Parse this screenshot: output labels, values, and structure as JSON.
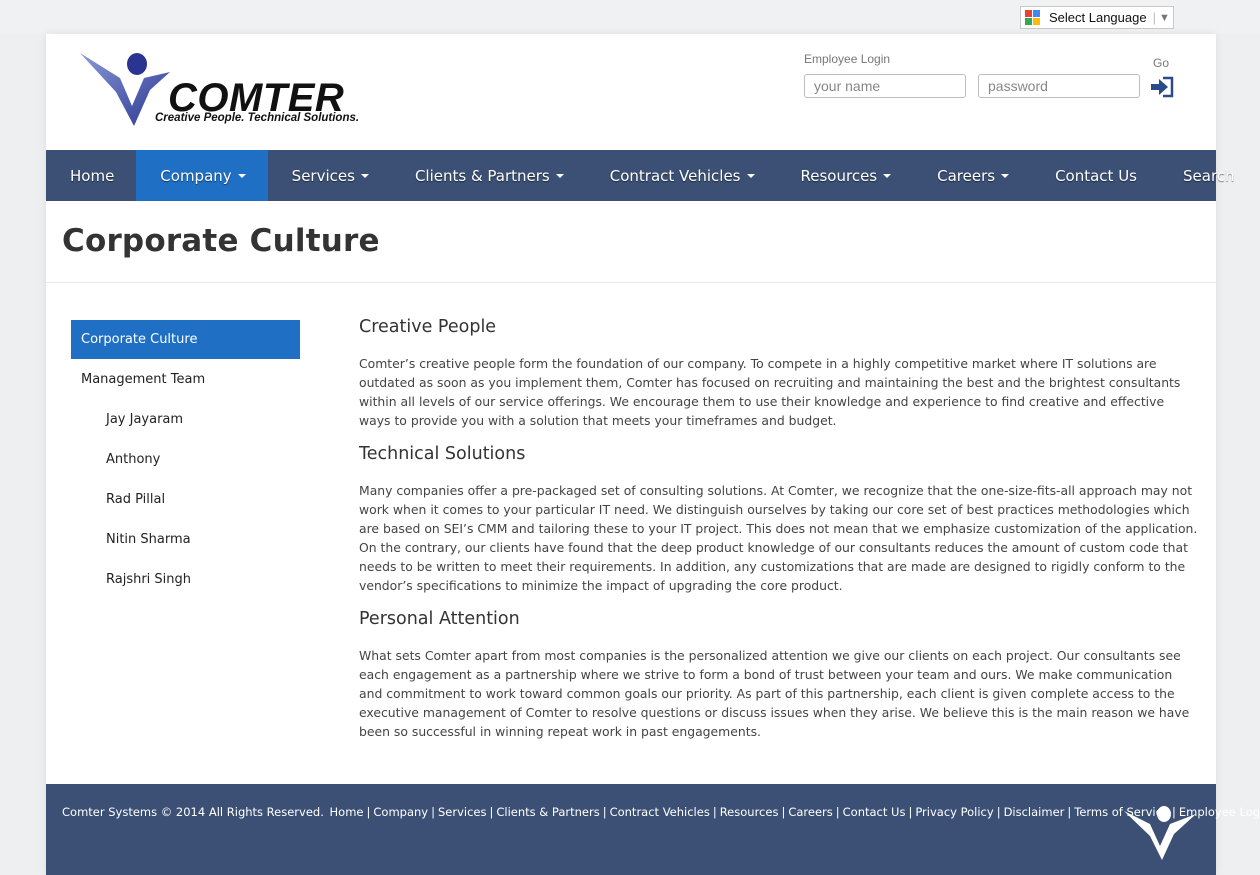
{
  "translate": {
    "label": "Select Language",
    "arrow": "▼"
  },
  "logo": {
    "name": "COMTER",
    "tagline": "Creative People. Technical Solutions."
  },
  "login": {
    "title": "Employee Login",
    "username_placeholder": "your name",
    "password_placeholder": "password",
    "go_label": "Go"
  },
  "nav": [
    {
      "label": "Home",
      "dropdown": false,
      "active": false
    },
    {
      "label": "Company",
      "dropdown": true,
      "active": true
    },
    {
      "label": "Services",
      "dropdown": true,
      "active": false
    },
    {
      "label": "Clients & Partners",
      "dropdown": true,
      "active": false
    },
    {
      "label": "Contract Vehicles",
      "dropdown": true,
      "active": false
    },
    {
      "label": "Resources",
      "dropdown": true,
      "active": false
    },
    {
      "label": "Careers",
      "dropdown": true,
      "active": false
    },
    {
      "label": "Contact Us",
      "dropdown": false,
      "active": false
    },
    {
      "label": "Search",
      "dropdown": false,
      "active": false
    }
  ],
  "page_title": "Corporate Culture",
  "sidebar": [
    {
      "label": "Corporate Culture",
      "active": true,
      "sub": false
    },
    {
      "label": "Management Team",
      "active": false,
      "sub": false
    },
    {
      "label": "Jay Jayaram",
      "active": false,
      "sub": true
    },
    {
      "label": "Anthony",
      "active": false,
      "sub": true
    },
    {
      "label": "Rad Pillal",
      "active": false,
      "sub": true
    },
    {
      "label": "Nitin Sharma",
      "active": false,
      "sub": true
    },
    {
      "label": "Rajshri Singh",
      "active": false,
      "sub": true
    }
  ],
  "sections": [
    {
      "heading": "Creative People",
      "body": "Comter’s creative people form the foundation of our company. To compete in a highly competitive market where IT solutions are outdated as soon as you implement them, Comter has focused on recruiting and maintaining the best and the brightest consultants within all levels of our service offerings. We encourage them to use their knowledge and experience to find creative and effective ways to provide you with a solution that meets your timeframes and budget."
    },
    {
      "heading": "Technical Solutions",
      "body": "Many companies offer a pre-packaged set of consulting solutions.  At Comter, we recognize that the one-size-fits-all approach may not work when it comes to your particular IT need.  We distinguish ourselves by taking our core set of best practices methodologies which are based on SEI’s CMM and tailoring these to your IT project.  This does not mean that we emphasize customization of the application.  On the contrary, our clients have found that the deep product knowledge of our consultants reduces the amount of custom code that needs to be written to meet their requirements.  In addition, any customizations that are made are designed to rigidly conform to the vendor’s specifications to minimize the impact of upgrading the core product."
    },
    {
      "heading": "Personal Attention",
      "body": "What sets Comter apart from most companies is the personalized attention we give our clients on each project.  Our consultants see each engagement as a partnership where we strive to form a bond of trust between your team and ours.  We make communication and commitment to work toward common goals our priority.  As part of this partnership, each client is given complete access to the executive management of Comter to resolve questions or discuss issues when they arise. We believe this is the main reason we have been so successful in winning repeat work in past engagements."
    }
  ],
  "footer": {
    "copyright": "Comter Systems © 2014 All Rights Reserved.",
    "links": [
      "Home",
      "Company",
      "Services",
      "Clients & Partners",
      "Contract Vehicles",
      "Resources",
      "Careers",
      "Contact Us",
      "Privacy Policy",
      "Disclaimer",
      "Terms of Service",
      "Employee Login"
    ]
  },
  "colors": {
    "nav_bg": "#3b5074",
    "active_blue": "#1f6fc5",
    "footer_bg": "#3b5074"
  },
  "icons": {
    "translate": "google-translate-icon",
    "go": "login-arrow-icon",
    "footer_logo": "comter-v-logo-icon"
  }
}
